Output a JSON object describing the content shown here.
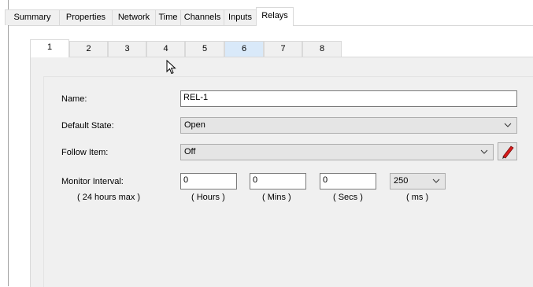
{
  "tabs": [
    {
      "label": "Summary"
    },
    {
      "label": "Properties"
    },
    {
      "label": "Network"
    },
    {
      "label": "Time"
    },
    {
      "label": "Channels"
    },
    {
      "label": "Inputs"
    },
    {
      "label": "Relays"
    }
  ],
  "selected_tab": "Relays",
  "relay_tabs": [
    "1",
    "2",
    "3",
    "4",
    "5",
    "6",
    "7",
    "8"
  ],
  "selected_relay": "1",
  "form": {
    "name_label": "Name:",
    "name_value": "REL-1",
    "default_state_label": "Default State:",
    "default_state_value": "Open",
    "follow_item_label": "Follow Item:",
    "follow_item_value": "Off",
    "monitor_interval_label": "Monitor Interval:",
    "monitor_interval_note": "( 24 hours max )",
    "hours_value": "0",
    "hours_label": "( Hours )",
    "mins_value": "0",
    "mins_label": "( Mins )",
    "secs_value": "0",
    "secs_label": "( Secs )",
    "ms_value": "250",
    "ms_label": "( ms )"
  },
  "icons": {
    "edit": "pencil-icon",
    "dropdown": "chevron-down-icon",
    "cursor": "mouse-pointer-icon"
  },
  "colors": {
    "panel_bg": "#f0f0f0",
    "tinted_tab": "#d9e9f9",
    "pen_red": "#d81b1b"
  }
}
